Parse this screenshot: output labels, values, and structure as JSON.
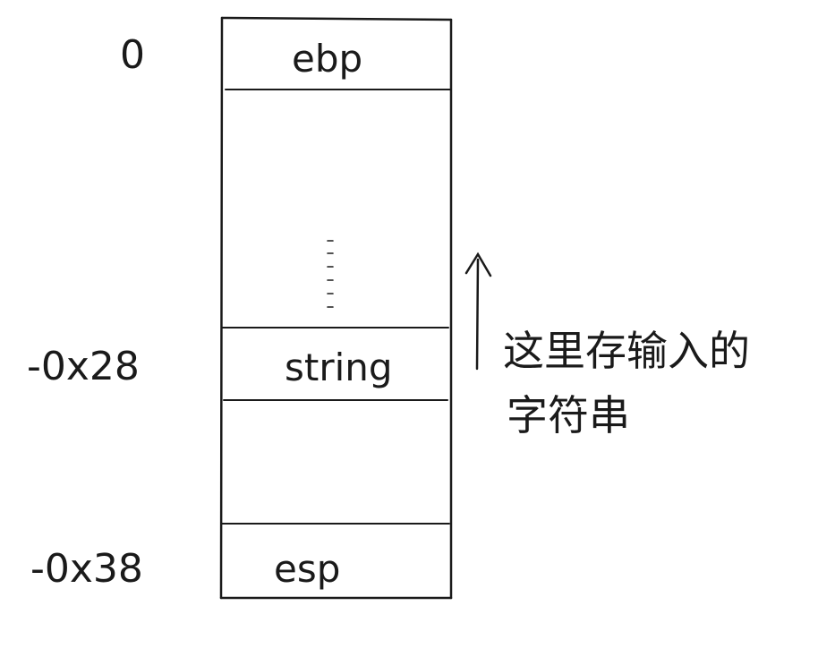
{
  "offsets": {
    "top": "0",
    "string": "-0x28",
    "bottom": "-0x38"
  },
  "cells": {
    "ebp": "ebp",
    "string": "string",
    "esp": "esp"
  },
  "annotation": {
    "line1": "这里存输入的",
    "line2": "字符串"
  },
  "colors": {
    "ink": "#1a1a1a",
    "background": "#ffffff"
  }
}
